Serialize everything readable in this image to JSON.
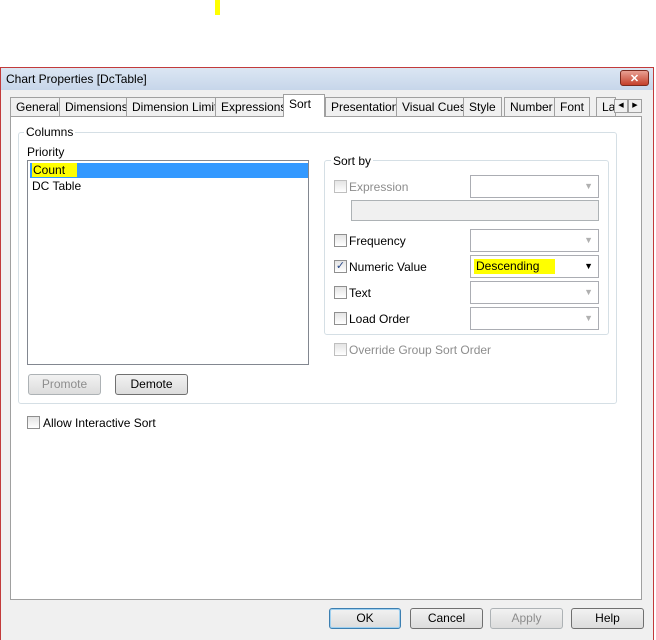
{
  "window": {
    "title": "Chart Properties [DcTable]",
    "close_icon": "close-icon"
  },
  "tabs": [
    {
      "label": "General"
    },
    {
      "label": "Dimensions"
    },
    {
      "label": "Dimension Limits"
    },
    {
      "label": "Expressions"
    },
    {
      "label": "Sort",
      "active": true
    },
    {
      "label": "Presentation"
    },
    {
      "label": "Visual Cues"
    },
    {
      "label": "Style"
    },
    {
      "label": "Number"
    },
    {
      "label": "Font"
    },
    {
      "label": "La"
    }
  ],
  "columns": {
    "group_label": "Columns",
    "priority_label": "Priority",
    "items": [
      {
        "label": "Count",
        "selected": true
      },
      {
        "label": "DC Table"
      }
    ],
    "promote": "Promote",
    "demote": "Demote"
  },
  "sort_by": {
    "group_label": "Sort by",
    "expression": {
      "label": "Expression",
      "checked": false,
      "enabled": false
    },
    "frequency": {
      "label": "Frequency",
      "checked": false
    },
    "numeric": {
      "label": "Numeric Value",
      "checked": true,
      "value": "Descending"
    },
    "text": {
      "label": "Text",
      "checked": false
    },
    "load_order": {
      "label": "Load Order",
      "checked": false
    },
    "override": {
      "label": "Override Group Sort Order",
      "checked": false,
      "enabled": false
    }
  },
  "allow_interactive": {
    "label": "Allow Interactive Sort",
    "checked": false
  },
  "buttons": {
    "ok": "OK",
    "cancel": "Cancel",
    "apply": "Apply",
    "help": "Help"
  },
  "colors": {
    "highlight": "#ffff00",
    "selection": "#3399ff"
  }
}
